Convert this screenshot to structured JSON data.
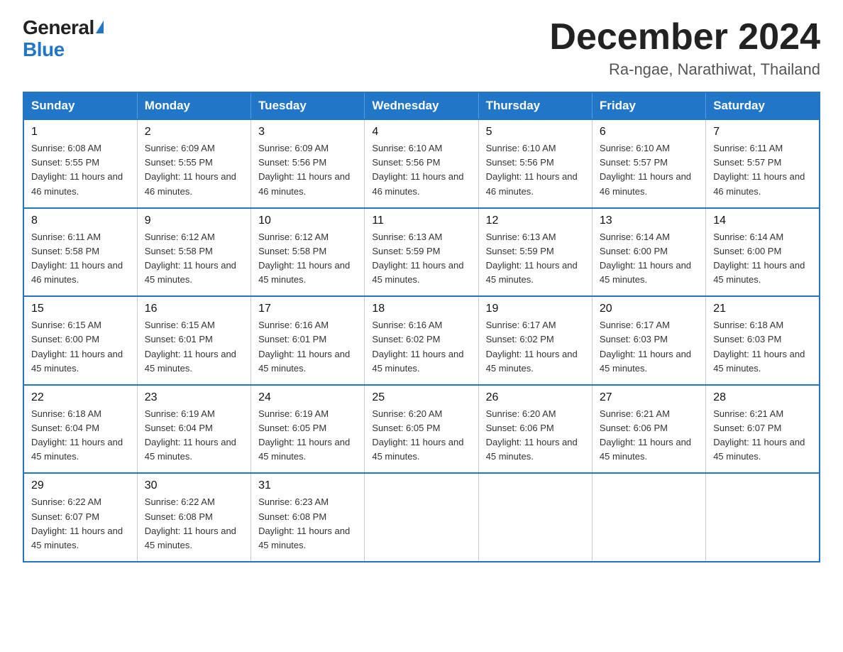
{
  "logo": {
    "general": "General",
    "blue": "Blue"
  },
  "title": "December 2024",
  "subtitle": "Ra-ngae, Narathiwat, Thailand",
  "weekdays": [
    "Sunday",
    "Monday",
    "Tuesday",
    "Wednesday",
    "Thursday",
    "Friday",
    "Saturday"
  ],
  "weeks": [
    [
      {
        "day": "1",
        "sunrise": "6:08 AM",
        "sunset": "5:55 PM",
        "daylight": "11 hours and 46 minutes."
      },
      {
        "day": "2",
        "sunrise": "6:09 AM",
        "sunset": "5:55 PM",
        "daylight": "11 hours and 46 minutes."
      },
      {
        "day": "3",
        "sunrise": "6:09 AM",
        "sunset": "5:56 PM",
        "daylight": "11 hours and 46 minutes."
      },
      {
        "day": "4",
        "sunrise": "6:10 AM",
        "sunset": "5:56 PM",
        "daylight": "11 hours and 46 minutes."
      },
      {
        "day": "5",
        "sunrise": "6:10 AM",
        "sunset": "5:56 PM",
        "daylight": "11 hours and 46 minutes."
      },
      {
        "day": "6",
        "sunrise": "6:10 AM",
        "sunset": "5:57 PM",
        "daylight": "11 hours and 46 minutes."
      },
      {
        "day": "7",
        "sunrise": "6:11 AM",
        "sunset": "5:57 PM",
        "daylight": "11 hours and 46 minutes."
      }
    ],
    [
      {
        "day": "8",
        "sunrise": "6:11 AM",
        "sunset": "5:58 PM",
        "daylight": "11 hours and 46 minutes."
      },
      {
        "day": "9",
        "sunrise": "6:12 AM",
        "sunset": "5:58 PM",
        "daylight": "11 hours and 45 minutes."
      },
      {
        "day": "10",
        "sunrise": "6:12 AM",
        "sunset": "5:58 PM",
        "daylight": "11 hours and 45 minutes."
      },
      {
        "day": "11",
        "sunrise": "6:13 AM",
        "sunset": "5:59 PM",
        "daylight": "11 hours and 45 minutes."
      },
      {
        "day": "12",
        "sunrise": "6:13 AM",
        "sunset": "5:59 PM",
        "daylight": "11 hours and 45 minutes."
      },
      {
        "day": "13",
        "sunrise": "6:14 AM",
        "sunset": "6:00 PM",
        "daylight": "11 hours and 45 minutes."
      },
      {
        "day": "14",
        "sunrise": "6:14 AM",
        "sunset": "6:00 PM",
        "daylight": "11 hours and 45 minutes."
      }
    ],
    [
      {
        "day": "15",
        "sunrise": "6:15 AM",
        "sunset": "6:00 PM",
        "daylight": "11 hours and 45 minutes."
      },
      {
        "day": "16",
        "sunrise": "6:15 AM",
        "sunset": "6:01 PM",
        "daylight": "11 hours and 45 minutes."
      },
      {
        "day": "17",
        "sunrise": "6:16 AM",
        "sunset": "6:01 PM",
        "daylight": "11 hours and 45 minutes."
      },
      {
        "day": "18",
        "sunrise": "6:16 AM",
        "sunset": "6:02 PM",
        "daylight": "11 hours and 45 minutes."
      },
      {
        "day": "19",
        "sunrise": "6:17 AM",
        "sunset": "6:02 PM",
        "daylight": "11 hours and 45 minutes."
      },
      {
        "day": "20",
        "sunrise": "6:17 AM",
        "sunset": "6:03 PM",
        "daylight": "11 hours and 45 minutes."
      },
      {
        "day": "21",
        "sunrise": "6:18 AM",
        "sunset": "6:03 PM",
        "daylight": "11 hours and 45 minutes."
      }
    ],
    [
      {
        "day": "22",
        "sunrise": "6:18 AM",
        "sunset": "6:04 PM",
        "daylight": "11 hours and 45 minutes."
      },
      {
        "day": "23",
        "sunrise": "6:19 AM",
        "sunset": "6:04 PM",
        "daylight": "11 hours and 45 minutes."
      },
      {
        "day": "24",
        "sunrise": "6:19 AM",
        "sunset": "6:05 PM",
        "daylight": "11 hours and 45 minutes."
      },
      {
        "day": "25",
        "sunrise": "6:20 AM",
        "sunset": "6:05 PM",
        "daylight": "11 hours and 45 minutes."
      },
      {
        "day": "26",
        "sunrise": "6:20 AM",
        "sunset": "6:06 PM",
        "daylight": "11 hours and 45 minutes."
      },
      {
        "day": "27",
        "sunrise": "6:21 AM",
        "sunset": "6:06 PM",
        "daylight": "11 hours and 45 minutes."
      },
      {
        "day": "28",
        "sunrise": "6:21 AM",
        "sunset": "6:07 PM",
        "daylight": "11 hours and 45 minutes."
      }
    ],
    [
      {
        "day": "29",
        "sunrise": "6:22 AM",
        "sunset": "6:07 PM",
        "daylight": "11 hours and 45 minutes."
      },
      {
        "day": "30",
        "sunrise": "6:22 AM",
        "sunset": "6:08 PM",
        "daylight": "11 hours and 45 minutes."
      },
      {
        "day": "31",
        "sunrise": "6:23 AM",
        "sunset": "6:08 PM",
        "daylight": "11 hours and 45 minutes."
      },
      null,
      null,
      null,
      null
    ]
  ],
  "labels": {
    "sunrise": "Sunrise:",
    "sunset": "Sunset:",
    "daylight": "Daylight:"
  }
}
